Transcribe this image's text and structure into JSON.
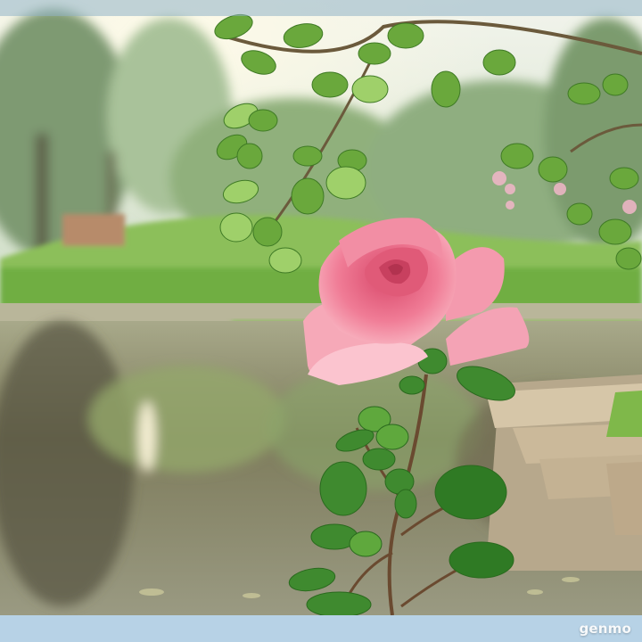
{
  "scene": {
    "subject": "pink-rose",
    "colors": {
      "sky": "#e6eee6",
      "foliage_far": "#8fb27e",
      "lawn": "#7fbf55",
      "water": "#8c8a6a",
      "rose_petal": "#f07c96",
      "rose_center": "#d94a6a",
      "leaf": "#3f8a2f",
      "stone_path": "#c9b79a"
    }
  },
  "watermark": {
    "text": "genmo"
  }
}
